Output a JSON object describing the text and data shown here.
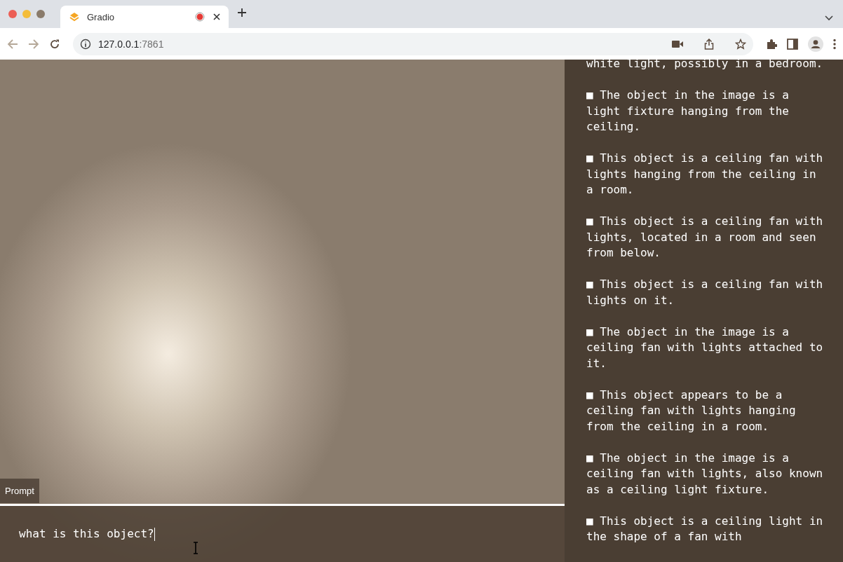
{
  "browser": {
    "tab": {
      "title": "Gradio"
    },
    "url": {
      "host": "127.0.0.1",
      "port": ":7861"
    }
  },
  "prompt": {
    "label": "Prompt",
    "value": "what is this object?"
  },
  "responses": [
    "white light, possibly in a bedroom.",
    "■ The object in the image is a light fixture hanging from the ceiling.",
    "■ This object is a ceiling fan with lights hanging from the ceiling in a room.",
    "■ This object is a ceiling fan with lights, located in a room and seen from below.",
    "■ This object is a ceiling fan with lights on it.",
    "■ The object in the image is a ceiling fan with lights attached to it.",
    "■ This object appears to be a ceiling fan with lights hanging from the ceiling in a room.",
    "■ The object in the image is a ceiling fan with lights, also known as a ceiling light fixture.",
    "■ This object is a ceiling light in the shape of a fan with"
  ]
}
